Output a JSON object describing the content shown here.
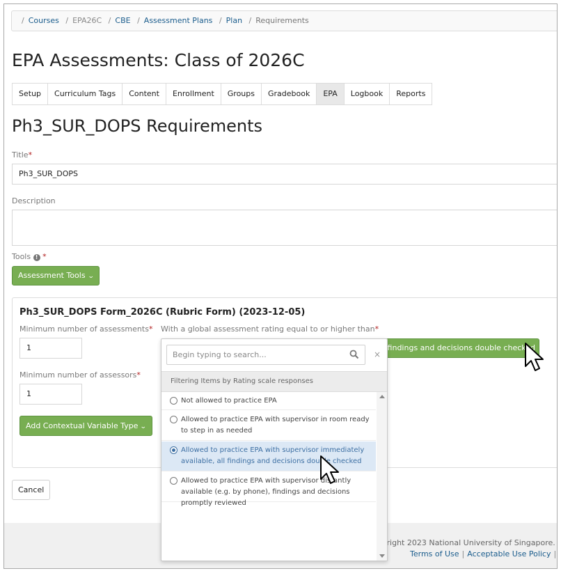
{
  "breadcrumb": {
    "items": [
      "Courses",
      "EPA26C",
      "CBE",
      "Assessment Plans",
      "Plan",
      "Requirements"
    ]
  },
  "page_title": "EPA Assessments: Class of 2026C",
  "tabs": [
    "Setup",
    "Curriculum Tags",
    "Content",
    "Enrollment",
    "Groups",
    "Gradebook",
    "EPA",
    "Logbook",
    "Reports"
  ],
  "active_tab": "EPA",
  "section_title": "Ph3_SUR_DOPS Requirements",
  "form": {
    "title_label": "Title",
    "title_value": "Ph3_SUR_DOPS",
    "description_label": "Description",
    "description_value": "",
    "tools_label": "Tools",
    "required_marker": "*",
    "assessment_tools_button": "Assessment Tools"
  },
  "panel": {
    "title": "Ph3_SUR_DOPS Form_2026C (Rubric Form) (2023-12-05)",
    "min_assessments_label": "Minimum number of assessments",
    "min_assessments_value": "1",
    "global_rating_label": "With a global assessment rating equal to or higher than",
    "selected_rating_visible": "l findings and decisions double checked",
    "min_assessors_label": "Minimum number of assessors",
    "min_assessors_value": "1",
    "add_variable_button": "Add Contextual Variable Type"
  },
  "cancel_button": "Cancel",
  "footer": {
    "copyright": "yright 2023 National University of Singapore.",
    "terms": "Terms of Use",
    "acceptable_use": "Acceptable Use Policy",
    "trailing": "("
  },
  "dropdown": {
    "search_placeholder": "Begin typing to search...",
    "close_glyph": "×",
    "header": "Filtering Items by Rating scale responses",
    "options": [
      {
        "label": "Not allowed to practice EPA",
        "selected": false
      },
      {
        "label": "Allowed to practice EPA with supervisor in room ready to step in as needed",
        "selected": false
      },
      {
        "label": "Allowed to practice EPA with supervisor immediately available, all findings and decisions double checked",
        "selected": true
      },
      {
        "label": "Allowed to practice EPA with supervisor distantly available (e.g. by phone), findings and decisions promptly reviewed",
        "selected": false
      }
    ]
  },
  "colors": {
    "green": "#78ae52",
    "link": "#1a5c8c",
    "required": "#b01c1c",
    "selected_bg": "#dce8f5"
  },
  "icons": [
    "info-icon",
    "chevron-down-icon",
    "search-icon",
    "close-icon",
    "radio-icon",
    "scroll-up-icon",
    "scroll-down-icon",
    "mouse-pointer-icon"
  ]
}
